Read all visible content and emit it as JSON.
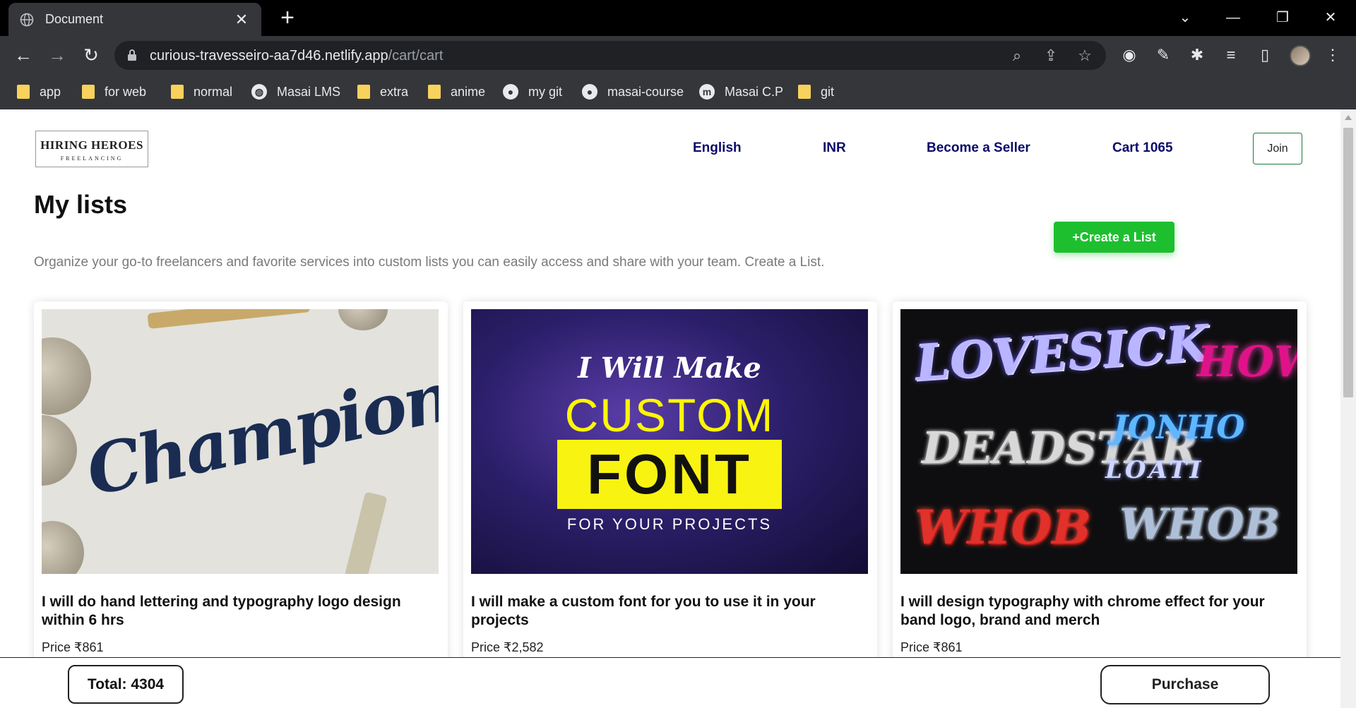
{
  "browser": {
    "tab_title": "Document",
    "new_tab_symbol": "+",
    "close_symbol": "✕",
    "url_host": "curious-travesseiro-aa7d46.netlify.app",
    "url_path": "/cart/cart",
    "bookmarks": [
      {
        "label": "app",
        "icon": "folder-icon"
      },
      {
        "label": "for web",
        "icon": "folder-icon"
      },
      {
        "label": "normal",
        "icon": "folder-icon"
      },
      {
        "label": "Masai LMS",
        "icon": "globe-icon"
      },
      {
        "label": "extra",
        "icon": "folder-icon"
      },
      {
        "label": "anime",
        "icon": "folder-icon"
      },
      {
        "label": "my git",
        "icon": "github-icon"
      },
      {
        "label": "masai-course",
        "icon": "github-icon"
      },
      {
        "label": "Masai C.P",
        "icon": "m-icon"
      },
      {
        "label": "git",
        "icon": "folder-icon"
      }
    ]
  },
  "header": {
    "logo_line1": "HIRING HEROES",
    "logo_line2": "FREELANCING",
    "nav": {
      "language": "English",
      "currency": "INR",
      "seller": "Become a Seller",
      "cart": "Cart 1065"
    },
    "join_label": "Join"
  },
  "main": {
    "title": "My lists",
    "description": "Organize your go-to freelancers and favorite services into custom lists you can easily access and share with your team. Create a List.",
    "create_label": "+Create a List",
    "cards": [
      {
        "title": "I will do hand lettering and typography logo design within 6 hrs",
        "price": "Price ₹861",
        "image_text": "Champion"
      },
      {
        "title": "I will make a custom font for you to use it in your projects",
        "price": "Price ₹2,582",
        "image_line1": "I Will Make",
        "image_line2": "CUSTOM",
        "image_line3": "FONT",
        "image_line4": "FOR YOUR PROJECTS"
      },
      {
        "title": "I will design typography with chrome effect for your band logo, brand and merch",
        "price": "Price ₹861",
        "image_words": [
          "LOVESICK",
          "HOWZ",
          "DEADSTAR",
          "JONHO",
          "LOATI",
          "WHOB"
        ]
      }
    ]
  },
  "footer": {
    "total": "Total: 4304",
    "purchase_label": "Purchase"
  },
  "colors": {
    "accent_green": "#1dbf2f",
    "nav_blue": "#0a0a6b"
  }
}
